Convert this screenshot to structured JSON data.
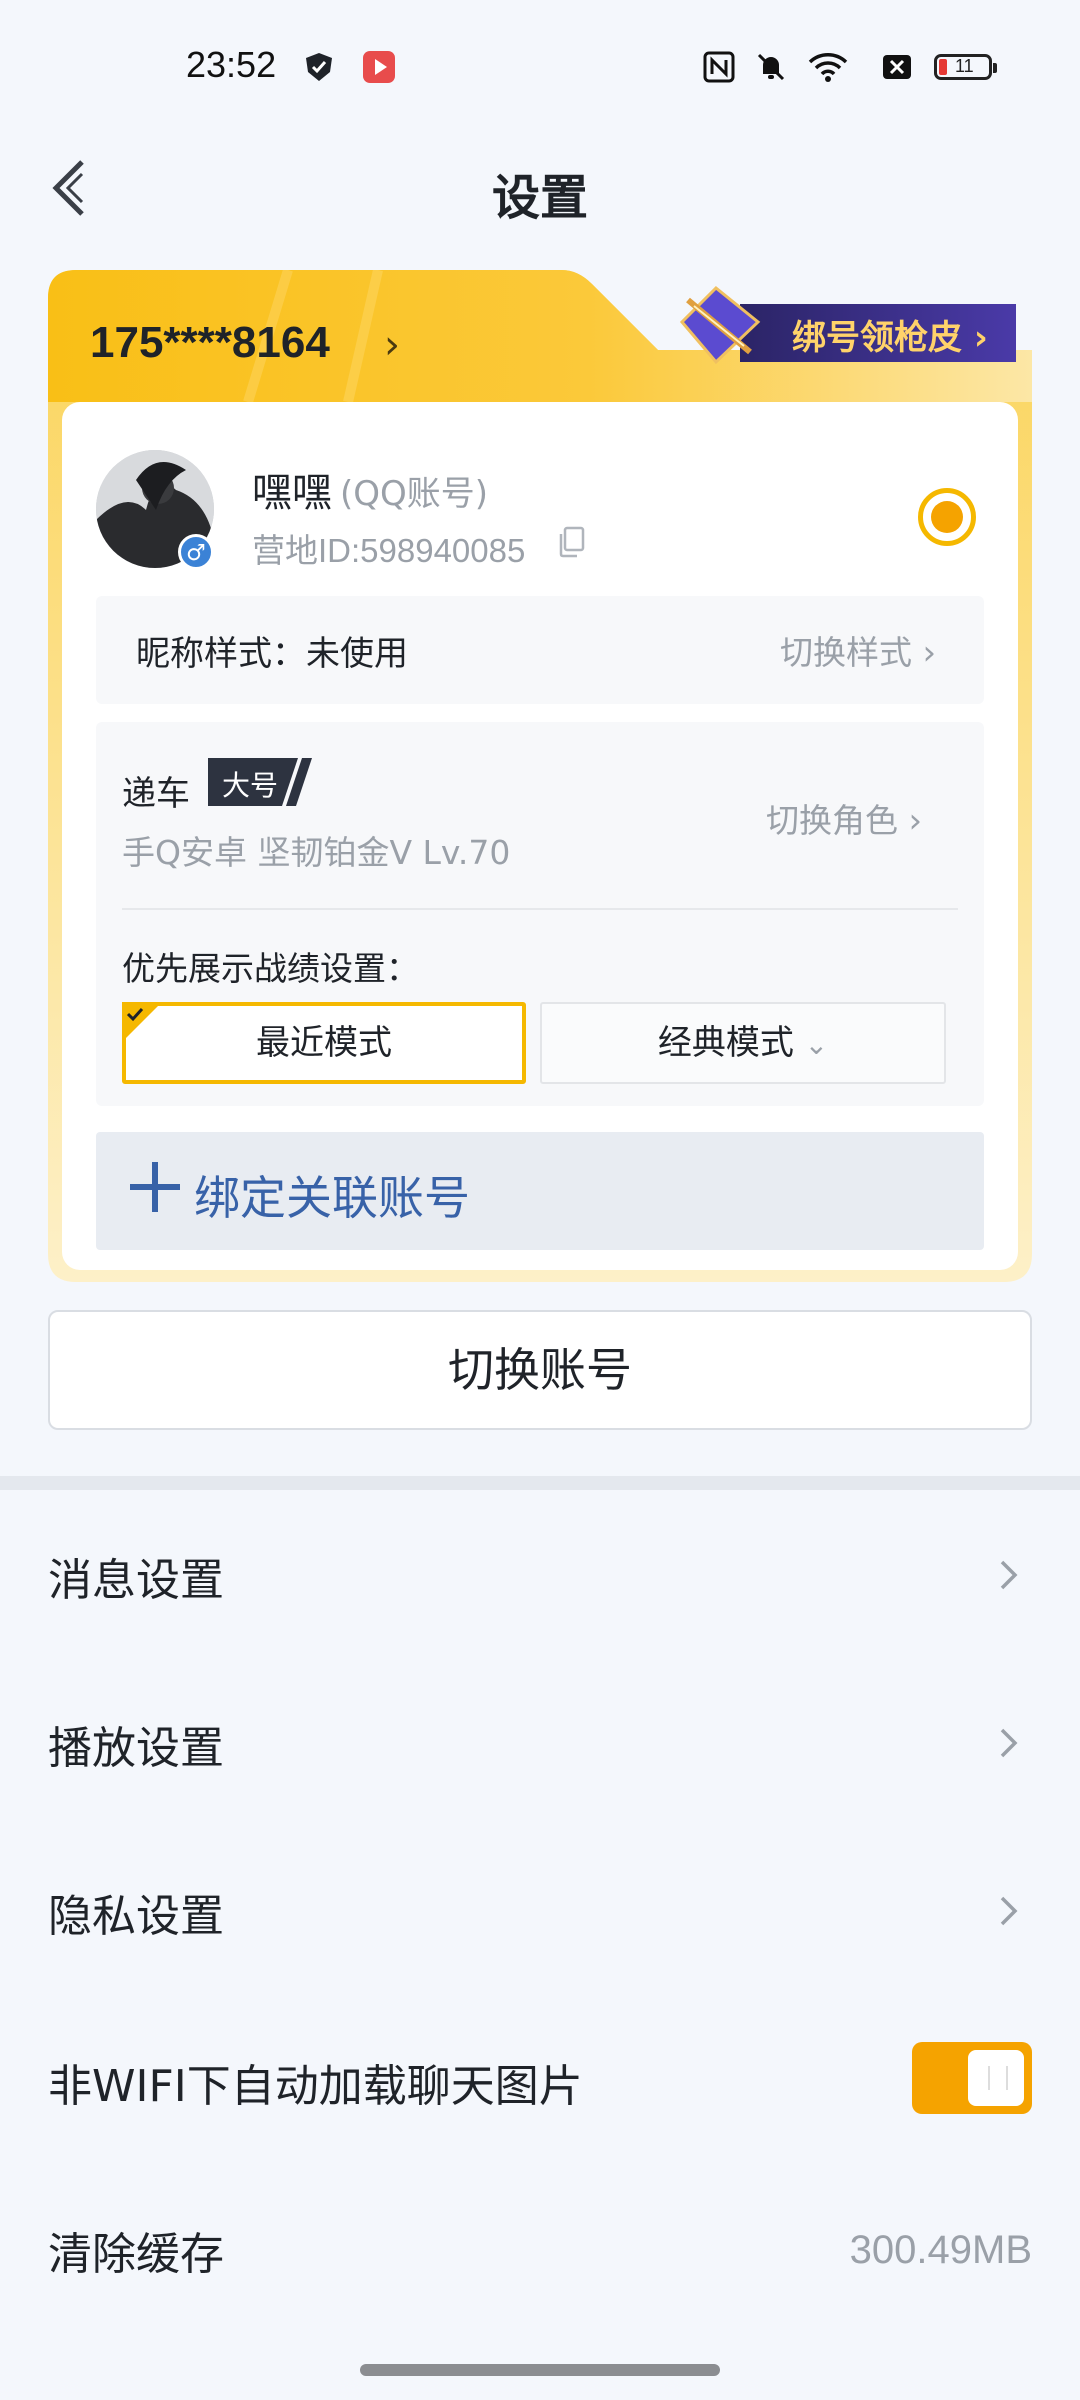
{
  "status_bar": {
    "time": "23:52",
    "left_icons": [
      "shield-app-icon",
      "video-app-icon"
    ],
    "right_icons": [
      "nfc-icon",
      "mute-icon",
      "wifi-icon",
      "sim-off-icon",
      "battery-icon"
    ],
    "battery_level": "11"
  },
  "header": {
    "title": "设置",
    "back_icon": "chevron-left-icon"
  },
  "account_card": {
    "phone": "175****8164",
    "phone_chevron": "›",
    "promo_label": "绑号领枪皮 ›",
    "user_name": "嘿嘿",
    "account_type": "(QQ账号)",
    "camp_id": "营地ID:598940085",
    "gender_symbol": "♂",
    "nickname_style_label": "昵称样式：未使用",
    "nickname_style_action": "切换样式",
    "role_name": "递车",
    "role_tag": "大号",
    "role_meta": "手Q安卓  坚韧铂金V  Lv.70",
    "role_action": "切换角色",
    "priority_label": "优先展示战绩设置：",
    "mode_recent": "最近模式",
    "mode_classic": "经典模式",
    "bind_linked": "绑定关联账号"
  },
  "switch_account": "切换账号",
  "menu": {
    "message_settings": "消息设置",
    "playback_settings": "播放设置",
    "privacy_settings": "隐私设置",
    "auto_load_images": "非WIFI下自动加载聊天图片",
    "auto_load_images_on": true,
    "clear_cache": "清除缓存",
    "cache_size": "300.49MB"
  },
  "colors": {
    "accent": "#f5a300",
    "card_yellow": "#f9c21b",
    "link_blue": "#3862a8",
    "text_secondary": "#9aa0a8"
  }
}
